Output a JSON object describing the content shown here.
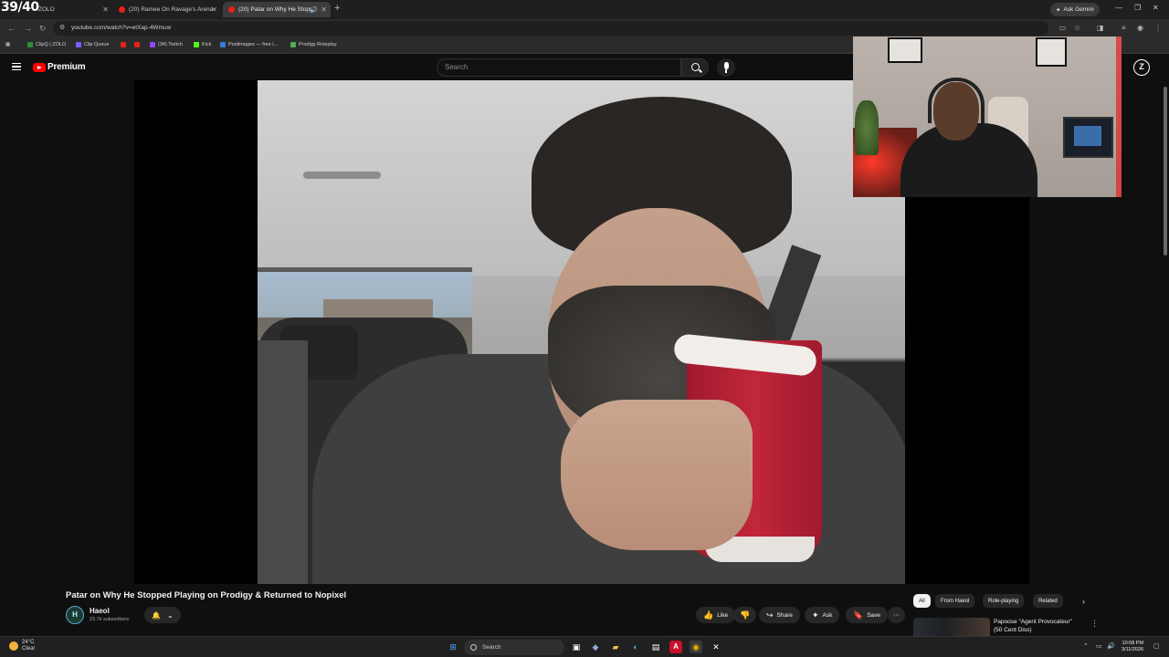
{
  "overlay": {
    "counter": "39/40"
  },
  "browser": {
    "tabs": [
      {
        "label": "ZOLO",
        "active": false
      },
      {
        "label": "(20) Ramee On Ravage's Arena",
        "active": false
      },
      {
        "label": "(20) Patar on Why He Stopp",
        "active": true
      }
    ],
    "ask_gemini": "Ask Gemini",
    "url": "youtube.com/watch?v=etXap-4Wmuw",
    "bookmarks": [
      {
        "label": "ClipQ | ZOLO",
        "color": "#2d8f3c"
      },
      {
        "label": "Clip Queue",
        "color": "#7c5cff"
      },
      {
        "label": "",
        "color": "#e62117"
      },
      {
        "label": "",
        "color": "#e62117"
      },
      {
        "label": "(34) Twitch",
        "color": "#9146ff"
      },
      {
        "label": "Kick",
        "color": "#53fc18"
      },
      {
        "label": "Postimages — free i...",
        "color": "#3a7bd5"
      },
      {
        "label": "Prodigy Roleplay",
        "color": "#4caf50"
      }
    ]
  },
  "youtube": {
    "brand": "Premium",
    "search_placeholder": "Search",
    "avatar_letter": "Z",
    "video": {
      "title": "Patar on Why He Stopped Playing on Prodigy & Returned to Nopixel"
    },
    "channel": {
      "initial": "H",
      "name": "Haeol",
      "subscribers": "23.7k subscribers"
    },
    "actions": {
      "like": "Like",
      "share": "Share",
      "ask": "Ask",
      "save": "Save"
    },
    "chips": [
      "All",
      "From Haeol",
      "Role-playing",
      "Related"
    ],
    "recommendation": {
      "title": "Papoose \"Agent Provocateur\" (50 Cent Diss)"
    }
  },
  "taskbar": {
    "weather_temp": "24°C",
    "weather_desc": "Clear",
    "search_label": "Search",
    "time": "10:08 PM",
    "date": "3/11/2026"
  }
}
